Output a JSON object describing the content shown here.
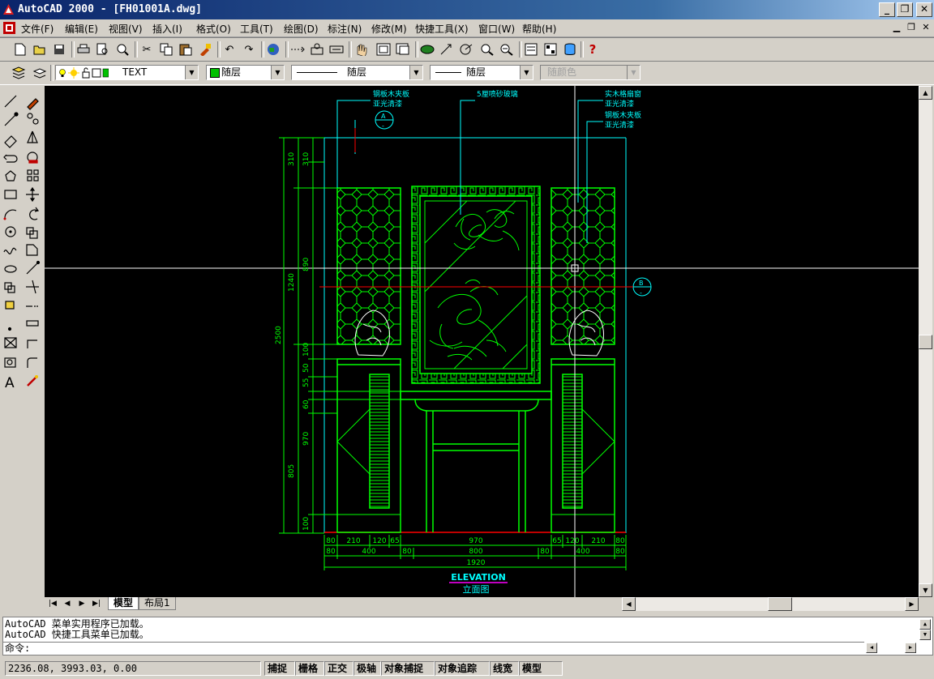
{
  "window": {
    "title": "AutoCAD 2000 - [FH01001A.dwg]",
    "minimize": "_",
    "restore": "❐",
    "close": "✕"
  },
  "menu": [
    "文件(F)",
    "编辑(E)",
    "视图(V)",
    "插入(I)",
    "格式(O)",
    "工具(T)",
    "绘图(D)",
    "标注(N)",
    "修改(M)",
    "快捷工具(X)",
    "窗口(W)",
    "帮助(H)"
  ],
  "layer_toolbar": {
    "layer_name": "TEXT",
    "color": "随层",
    "linetype": "随层",
    "lineweight": "随层",
    "plotstyle": "随颜色"
  },
  "drawing": {
    "annotations": {
      "top_left": [
        "钢板木夹板",
        "亚光清漆"
      ],
      "top_center": "5厘喷砂玻璃",
      "top_right_1": [
        "实木格扇窗",
        "亚光清漆"
      ],
      "top_right_2": [
        "钢板木夹板",
        "亚光清漆"
      ],
      "section_a_top": "A",
      "section_a_bottom": "-",
      "section_b_top": "B",
      "section_b_bottom": "-"
    },
    "left_dims": [
      "310",
      "310",
      "890",
      "1240",
      "2500",
      "100",
      "50",
      "55",
      "60",
      "970",
      "805",
      "100"
    ],
    "bottom_dims_row1": [
      "80",
      "210",
      "120",
      "65",
      "970",
      "65",
      "120",
      "210",
      "80"
    ],
    "bottom_dims_row2": [
      "80",
      "400",
      "80",
      "800",
      "80",
      "400",
      "80"
    ],
    "bottom_dims_total": "1920",
    "title_en": "ELEVATION",
    "title_cn": "立面图"
  },
  "tabs": {
    "model": "模型",
    "layout1": "布局1"
  },
  "command": {
    "line1": "AutoCAD 菜单实用程序已加载。",
    "line2": "AutoCAD 快捷工具菜单已加载。",
    "prompt": "命令:"
  },
  "status": {
    "coords": "2236.08, 3993.03, 0.00",
    "buttons": [
      "捕捉",
      "栅格",
      "正交",
      "极轴",
      "对象捕捉",
      "对象追踪",
      "线宽",
      "模型"
    ]
  },
  "colors": {
    "canvas_bg": "#000000",
    "line_green": "#00ff00",
    "line_cyan": "#00ffff",
    "line_red": "#ff0000",
    "line_magenta": "#ff00ff",
    "titlebar": "#0a246a"
  }
}
